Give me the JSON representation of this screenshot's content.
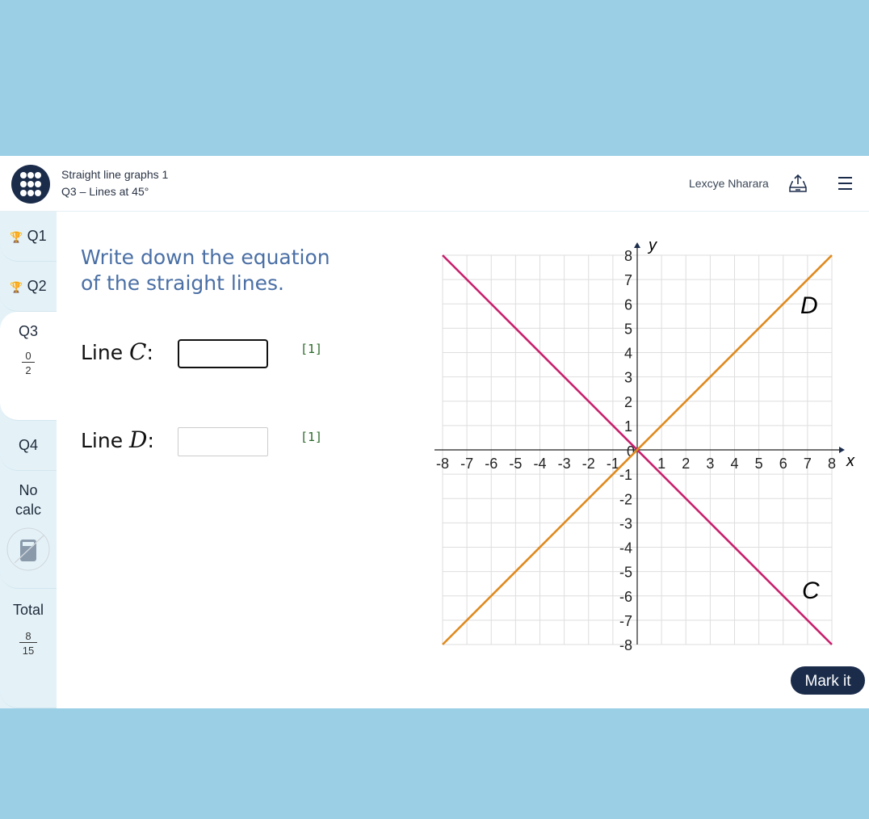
{
  "header": {
    "title": "Straight line graphs 1",
    "subtitle": "Q3 – Lines at 45°",
    "user": "Lexcye Nharara"
  },
  "sidebar": {
    "items": [
      {
        "label": "Q1",
        "icon": "trophy-icon"
      },
      {
        "label": "Q2",
        "icon": "trophy-icon"
      },
      {
        "label": "Q3",
        "score": "0",
        "total": "2"
      },
      {
        "label": "Q4"
      }
    ],
    "no_calc": "No calc",
    "total_label": "Total",
    "total_score": "8",
    "total_max": "15"
  },
  "question": {
    "prompt_line1": "Write down the equation",
    "prompt_line2": "of the straight lines.",
    "parts": [
      {
        "prefix": "Line ",
        "var": "C",
        "suffix": ":",
        "value": "",
        "marks": "[1]"
      },
      {
        "prefix": "Line ",
        "var": "D",
        "suffix": ":",
        "value": "",
        "marks": "[1]"
      }
    ],
    "mark_button": "Mark it"
  },
  "chart_data": {
    "type": "line",
    "xlabel": "x",
    "ylabel": "y",
    "xlim": [
      -8,
      8
    ],
    "ylim": [
      -8,
      8
    ],
    "grid": true,
    "xticks": [
      "-8",
      "-7",
      "-6",
      "-5",
      "-4",
      "-3",
      "-2",
      "-1",
      "0",
      "1",
      "2",
      "3",
      "4",
      "5",
      "6",
      "7",
      "8"
    ],
    "yticks": [
      "-8",
      "-7",
      "-6",
      "-5",
      "-4",
      "-3",
      "-2",
      "-1",
      "1",
      "2",
      "3",
      "4",
      "5",
      "6",
      "7",
      "8"
    ],
    "series": [
      {
        "name": "C",
        "points": [
          [
            -8,
            8
          ],
          [
            8,
            -8
          ]
        ],
        "color": "#c8216e"
      },
      {
        "name": "D",
        "points": [
          [
            -8,
            -8
          ],
          [
            8,
            8
          ]
        ],
        "color": "#e08a1e"
      }
    ]
  }
}
